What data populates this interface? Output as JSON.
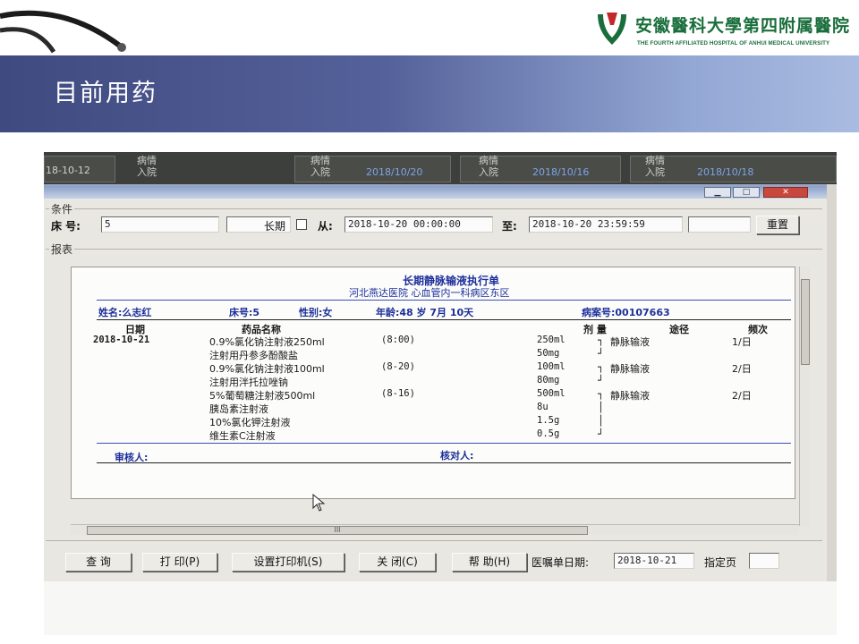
{
  "slide": {
    "title": "目前用药",
    "logo_cn": "安徽醫科大學第四附属醫院",
    "logo_en": "THE FOURTH AFFILIATED HOSPITAL OF ANHUI MEDICAL UNIVERSITY"
  },
  "background_app": {
    "cells": [
      {
        "text": "病情",
        "tone": "grey"
      },
      {
        "text": "入院",
        "tone": "grey"
      },
      {
        "text": "病情",
        "tone": "grey"
      },
      {
        "text": "入院",
        "tone": "grey"
      },
      {
        "text": "2018/10/20",
        "tone": "blue"
      },
      {
        "text": "病情",
        "tone": "grey"
      },
      {
        "text": "入院",
        "tone": "grey"
      },
      {
        "text": "2018/10/16",
        "tone": "blue"
      },
      {
        "text": "病情",
        "tone": "grey"
      },
      {
        "text": "入院",
        "tone": "grey"
      },
      {
        "text": "2018/10/18",
        "tone": "blue"
      },
      {
        "text": "18-10-12",
        "tone": "grey"
      }
    ]
  },
  "conditions": {
    "group_label": "条件",
    "bed_label": "床 号:",
    "bed_value": "5",
    "longterm_label": "长期",
    "from_label": "从:",
    "from_value": "2018-10-20 00:00:00",
    "to_label": "至:",
    "to_value": "2018-10-20 23:59:59",
    "reset_button": "重置"
  },
  "report": {
    "group_label": "报表",
    "title": "长期静脉输液执行单",
    "subtitle": "河北燕达医院  心血管内一科病区东区",
    "patient": {
      "name": "姓名:么志红",
      "bed": "床号:5",
      "sex": "性别:女",
      "age": "年龄:48 岁 7月 10天",
      "record": "病案号:00107663"
    },
    "columns": {
      "date": "日期",
      "drug": "药品名称",
      "dose": "剂 量",
      "route": "途径",
      "freq": "频次"
    },
    "date_value": "2018-10-21",
    "rows": [
      {
        "drug": "0.9%氯化钠注射液250ml",
        "time": "(8:00)",
        "dose": "250ml",
        "bracket": "┐",
        "route": "静脉输液",
        "freq": "1/日"
      },
      {
        "drug": "注射用丹参多酚酸盐",
        "time": "",
        "dose": "50mg",
        "bracket": "┘",
        "route": "",
        "freq": ""
      },
      {
        "drug": "0.9%氯化钠注射液100ml",
        "time": "(8-20)",
        "dose": "100ml",
        "bracket": "┐",
        "route": "静脉输液",
        "freq": "2/日"
      },
      {
        "drug": "注射用泮托拉唑钠",
        "time": "",
        "dose": "80mg",
        "bracket": "┘",
        "route": "",
        "freq": ""
      },
      {
        "drug": "5%葡萄糖注射液500ml",
        "time": "(8-16)",
        "dose": "500ml",
        "bracket": "┐",
        "route": "静脉输液",
        "freq": "2/日"
      },
      {
        "drug": "胰岛素注射液",
        "time": "",
        "dose": "8u",
        "bracket": "│",
        "route": "",
        "freq": ""
      },
      {
        "drug": "10%氯化钾注射液",
        "time": "",
        "dose": "1.5g",
        "bracket": "│",
        "route": "",
        "freq": ""
      },
      {
        "drug": "维生素C注射液",
        "time": "",
        "dose": "0.5g",
        "bracket": "┘",
        "route": "",
        "freq": ""
      }
    ],
    "reviewer_label": "审核人:",
    "checker_label": "核对人:"
  },
  "toolbar": {
    "query": "查 询",
    "print": "打 印(P)",
    "printer_settings": "设置打印机(S)",
    "close": "关 闭(C)",
    "help": "帮 助(H)",
    "order_date_label": "医嘱单日期:",
    "order_date_value": "2018-10-21",
    "page_label": "指定页",
    "page_value": ""
  },
  "scroll": {
    "h_thumb_label": "III"
  },
  "colors": {
    "title_band_start": "#3f4a80",
    "title_band_end": "#a9bbe0",
    "logo_green": "#1a6e3c",
    "report_text_blue": "#1d2f9a"
  }
}
